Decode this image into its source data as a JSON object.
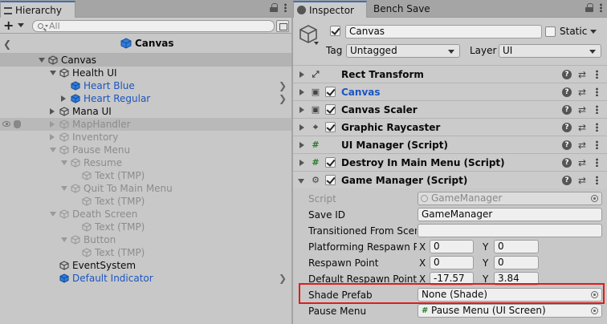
{
  "hierarchy": {
    "tab_label": "Hierarchy",
    "search_placeholder": "All",
    "breadcrumb_title": "Canvas",
    "items": [
      {
        "label": "Canvas",
        "indent": 0,
        "arrow": "down",
        "style": "normal",
        "selected": true
      },
      {
        "label": "Health UI",
        "indent": 1,
        "arrow": "down",
        "style": "normal"
      },
      {
        "label": "Heart Blue",
        "indent": 2,
        "arrow": "none",
        "style": "blue",
        "chevron": true
      },
      {
        "label": "Heart Regular",
        "indent": 2,
        "arrow": "right",
        "style": "blue",
        "chevron": true
      },
      {
        "label": "Mana UI",
        "indent": 1,
        "arrow": "right",
        "style": "normal"
      },
      {
        "label": "MapHandler",
        "indent": 1,
        "arrow": "right",
        "style": "gray",
        "highlight": true,
        "eye": true
      },
      {
        "label": "Inventory",
        "indent": 1,
        "arrow": "right",
        "style": "gray"
      },
      {
        "label": "Pause Menu",
        "indent": 1,
        "arrow": "down",
        "style": "gray"
      },
      {
        "label": "Resume",
        "indent": 2,
        "arrow": "down",
        "style": "gray"
      },
      {
        "label": "Text (TMP)",
        "indent": 3,
        "arrow": "none",
        "style": "gray"
      },
      {
        "label": "Quit To Main Menu",
        "indent": 2,
        "arrow": "down",
        "style": "gray"
      },
      {
        "label": "Text (TMP)",
        "indent": 3,
        "arrow": "none",
        "style": "gray"
      },
      {
        "label": "Death Screen",
        "indent": 1,
        "arrow": "down",
        "style": "gray"
      },
      {
        "label": "Text (TMP)",
        "indent": 3,
        "arrow": "none",
        "style": "gray"
      },
      {
        "label": "Button",
        "indent": 2,
        "arrow": "down",
        "style": "gray"
      },
      {
        "label": "Text (TMP)",
        "indent": 3,
        "arrow": "none",
        "style": "gray"
      },
      {
        "label": "EventSystem",
        "indent": 1,
        "arrow": "none",
        "style": "normal"
      },
      {
        "label": "Default Indicator",
        "indent": 1,
        "arrow": "none",
        "style": "blue",
        "chevron": true
      }
    ]
  },
  "inspector": {
    "tab_label": "Inspector",
    "tab2_label": "Bench Save",
    "object_name": "Canvas",
    "static_label": "Static",
    "tag_label": "Tag",
    "tag_value": "Untagged",
    "layer_label": "Layer",
    "layer_value": "UI",
    "components": [
      {
        "name": "Rect Transform",
        "icon": "rect-transform",
        "checkbox": false,
        "open": false,
        "blue": false
      },
      {
        "name": "Canvas",
        "icon": "canvas",
        "checkbox": true,
        "open": false,
        "blue": true
      },
      {
        "name": "Canvas Scaler",
        "icon": "canvas-scaler",
        "checkbox": true,
        "open": false,
        "blue": false
      },
      {
        "name": "Graphic Raycaster",
        "icon": "raycaster",
        "checkbox": true,
        "open": false,
        "blue": false
      },
      {
        "name": "UI Manager (Script)",
        "icon": "script",
        "checkbox": false,
        "open": false,
        "blue": false
      },
      {
        "name": "Destroy In Main Menu (Script)",
        "icon": "script",
        "checkbox": true,
        "open": false,
        "blue": false
      },
      {
        "name": "Game Manager (Script)",
        "icon": "gear",
        "checkbox": true,
        "open": true,
        "blue": false
      }
    ],
    "props": {
      "script_label": "Script",
      "script_value": "GameManager",
      "save_id_label": "Save ID",
      "save_id_value": "GameManager",
      "transitioned_label": "Transitioned From Scene",
      "transitioned_value": "",
      "platforming_label": "Platforming Respawn Point",
      "platforming_x": "0",
      "platforming_y": "0",
      "respawn_label": "Respawn Point",
      "respawn_x": "0",
      "respawn_y": "0",
      "default_respawn_label": "Default Respawn Point",
      "default_x": "-17.57",
      "default_y": "3.84",
      "x_label": "X",
      "y_label": "Y",
      "shade_label": "Shade Prefab",
      "shade_value": "None (Shade)",
      "pause_label": "Pause Menu",
      "pause_value": "Pause Menu (UI Screen)"
    }
  },
  "colors": {
    "highlight_box": "#e01c1c",
    "prefab_blue": "#1b55c0",
    "accent": "#3a72b0"
  }
}
